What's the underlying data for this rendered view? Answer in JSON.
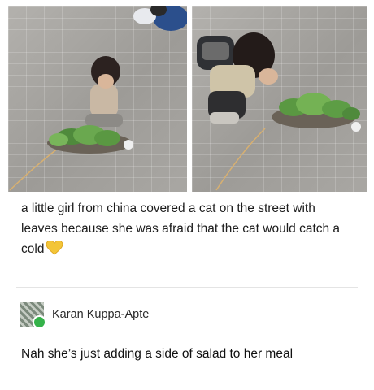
{
  "post": {
    "caption": "a little girl from china covered a cat on the street with leaves because she was afraid that the cat would catch a cold",
    "emoji": "yellow-heart-icon"
  },
  "reply": {
    "username": "Karan Kuppa-Apte",
    "text": "Nah she’s just adding a side of salad to her meal"
  }
}
